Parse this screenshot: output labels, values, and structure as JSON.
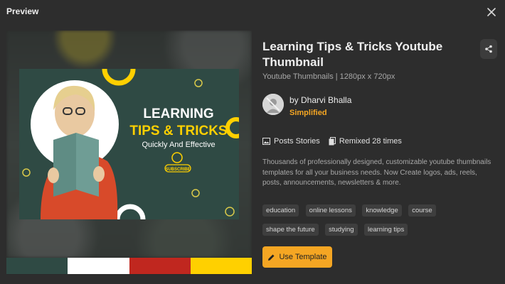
{
  "header": {
    "title": "Preview"
  },
  "template": {
    "title": "Learning Tips & Tricks Youtube Thumbnail",
    "subtitle": "Youtube Thumbnails | 1280px x 720px",
    "author_name": "by Dharvi Bhalla",
    "author_company": "Simplified",
    "category": "Posts Stories",
    "remix_count": "Remixed 28 times",
    "description": "Thousands of professionally designed, customizable youtube thumbnails templates for all your business needs. Now Create logos, ads, reels, posts, announcements, newsletters & more.",
    "tags": [
      "education",
      "online lessons",
      "knowledge",
      "course",
      "shape the future",
      "studying",
      "learning tips"
    ],
    "use_button_label": "Use Template"
  },
  "thumbnail": {
    "line1": "LEARNING",
    "line2": "TIPS & TRICKS",
    "line3": "Quickly And Effective",
    "subscribe": "SUBSCRIBE"
  },
  "palette": [
    "#2f4a44",
    "#ffffff",
    "#c0271f",
    "#ffd000"
  ],
  "icons": {
    "close": "close-icon",
    "share": "share-icon",
    "category": "image-icon",
    "remix": "copy-icon",
    "use": "pencil-icon"
  }
}
